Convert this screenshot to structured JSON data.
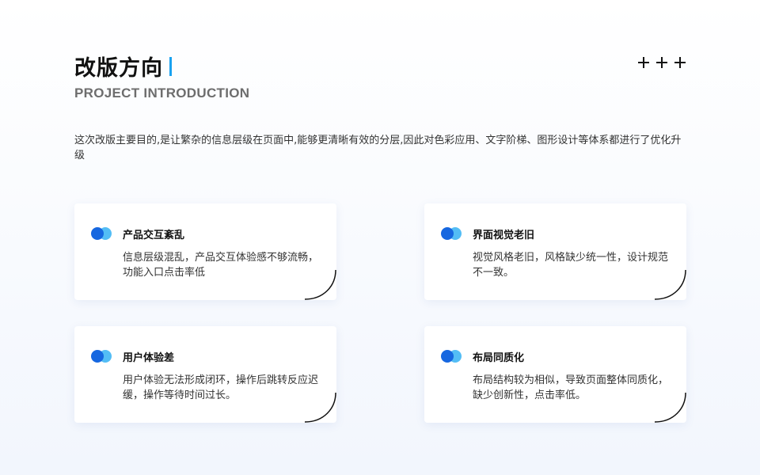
{
  "header": {
    "title": "改版方向",
    "subtitle": "PROJECT INTRODUCTION"
  },
  "intro": "这次改版主要目的,是让繁杂的信息层级在页面中,能够更清晰有效的分层,因此对色彩应用、文字阶梯、图形设计等体系都进行了优化升级",
  "colors": {
    "accent": "#1aa2f0",
    "icon_dark": "#1667e0",
    "icon_light": "#53bdf5"
  },
  "cards": [
    {
      "title": "产品交互紊乱",
      "body": "信息层级混乱，产品交互体验感不够流畅，功能入口点击率低"
    },
    {
      "title": "界面视觉老旧",
      "body": "视觉风格老旧，风格缺少统一性，设计规范不一致。"
    },
    {
      "title": "用户体验差",
      "body": "用户体验无法形成闭环，操作后跳转反应迟缓，操作等待时间过长。"
    },
    {
      "title": "布局同质化",
      "body": "布局结构较为相似，导致页面整体同质化，缺少创新性，点击率低。"
    }
  ]
}
